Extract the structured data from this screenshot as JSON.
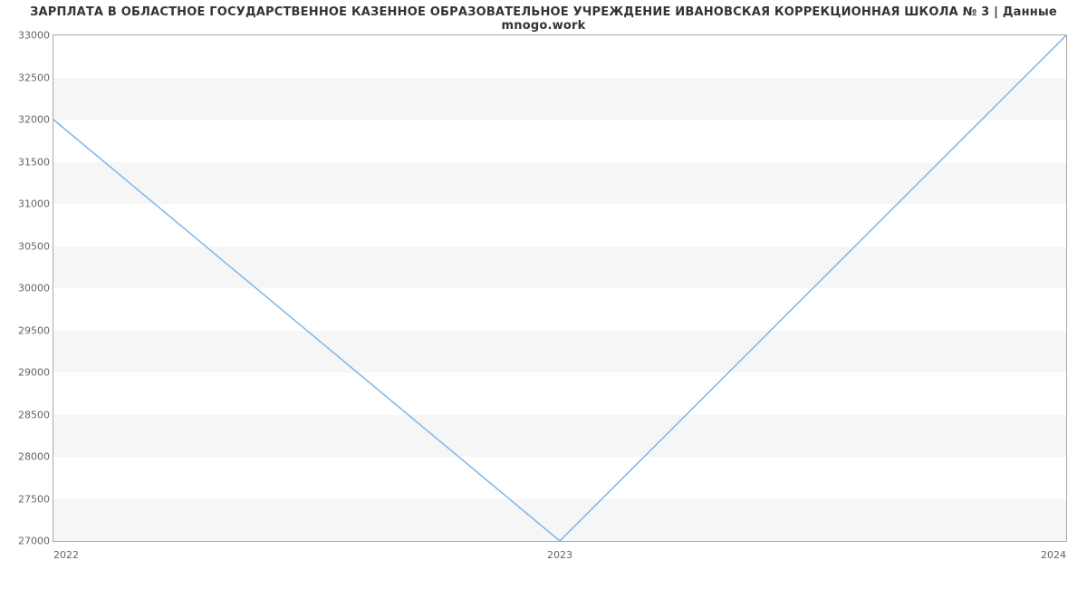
{
  "title": "ЗАРПЛАТА В ОБЛАСТНОЕ ГОСУДАРСТВЕННОЕ КАЗЕННОЕ ОБРАЗОВАТЕЛЬНОЕ УЧРЕЖДЕНИЕ ИВАНОВСКАЯ КОРРЕКЦИОННАЯ ШКОЛА № 3 | Данные mnogo.work",
  "y_ticks": [
    "27000",
    "27500",
    "28000",
    "28500",
    "29000",
    "29500",
    "30000",
    "30500",
    "31000",
    "31500",
    "32000",
    "32500",
    "33000"
  ],
  "x_ticks": [
    "2022",
    "2023",
    "2024"
  ],
  "chart_data": {
    "type": "line",
    "title": "ЗАРПЛАТА В ОБЛАСТНОЕ ГОСУДАРСТВЕННОЕ КАЗЕННОЕ ОБРАЗОВАТЕЛЬНОЕ УЧРЕЖДЕНИЕ ИВАНОВСКАЯ КОРРЕКЦИОННАЯ ШКОЛА № 3 | Данные mnogo.work",
    "xlabel": "",
    "ylabel": "",
    "ylim": [
      27000,
      33000
    ],
    "x": [
      2022,
      2023,
      2024
    ],
    "values": [
      32000,
      27000,
      33000
    ],
    "line_color": "#7cb5ec"
  }
}
